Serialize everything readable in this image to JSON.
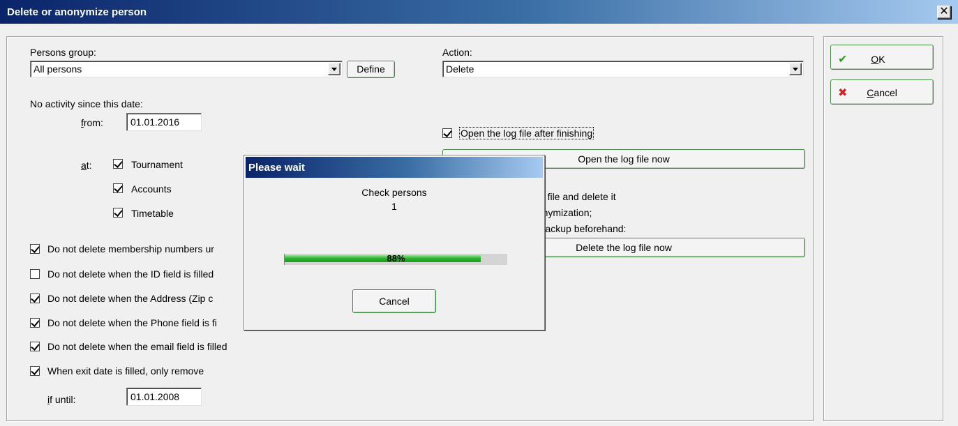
{
  "window": {
    "title": "Delete or anonymize person"
  },
  "persons_group": {
    "label": "Persons group:",
    "value": "All persons",
    "define_label": "Define"
  },
  "action": {
    "label": "Action:",
    "value": "Delete"
  },
  "activity": {
    "label": "No activity since this date:",
    "from_label_accel": "f",
    "from_label_rest": "rom:",
    "from_value": "01.01.2016",
    "at_label_accel": "a",
    "at_label_rest": "t:",
    "checks": [
      {
        "label": "Tournament",
        "checked": true
      },
      {
        "label": "Accounts",
        "checked": true
      },
      {
        "label": "Timetable",
        "checked": true
      }
    ]
  },
  "options": [
    {
      "label": "Do not delete membership numbers ur",
      "checked": true
    },
    {
      "label": "Do not delete when the ID field is filled",
      "checked": false
    },
    {
      "label": "Do not delete when the Address (Zip c",
      "checked": true
    },
    {
      "label": "Do not delete when the Phone field is fi",
      "checked": true
    },
    {
      "label": "Do not delete when the email field is filled",
      "checked": true
    },
    {
      "label": "When exit date is filled, only remove",
      "checked": true
    }
  ],
  "if_until": {
    "label_accel": "i",
    "label_rest": "f until:",
    "value": "01.01.2008"
  },
  "log": {
    "open_after_label": "Open the log file after finishing",
    "open_after_checked": true,
    "open_now_label": "Open the log file now",
    "info_line1": "log file and delete it",
    "info_line2": "nonymization;",
    "info_line3": "a backup beforehand:",
    "delete_now_label": "Delete the log file now"
  },
  "buttons": {
    "ok_accel": "O",
    "ok_rest": "K",
    "cancel_accel": "C",
    "cancel_rest": "ancel"
  },
  "wait_dialog": {
    "title": "Please wait",
    "status": "Check persons",
    "count": "1",
    "progress_text": "88%",
    "progress": 0.88,
    "cancel_label": "Cancel"
  },
  "colors": {
    "ok_check": "#2e9a2e",
    "cancel_x": "#d42020",
    "progress": "#2bb52b"
  }
}
